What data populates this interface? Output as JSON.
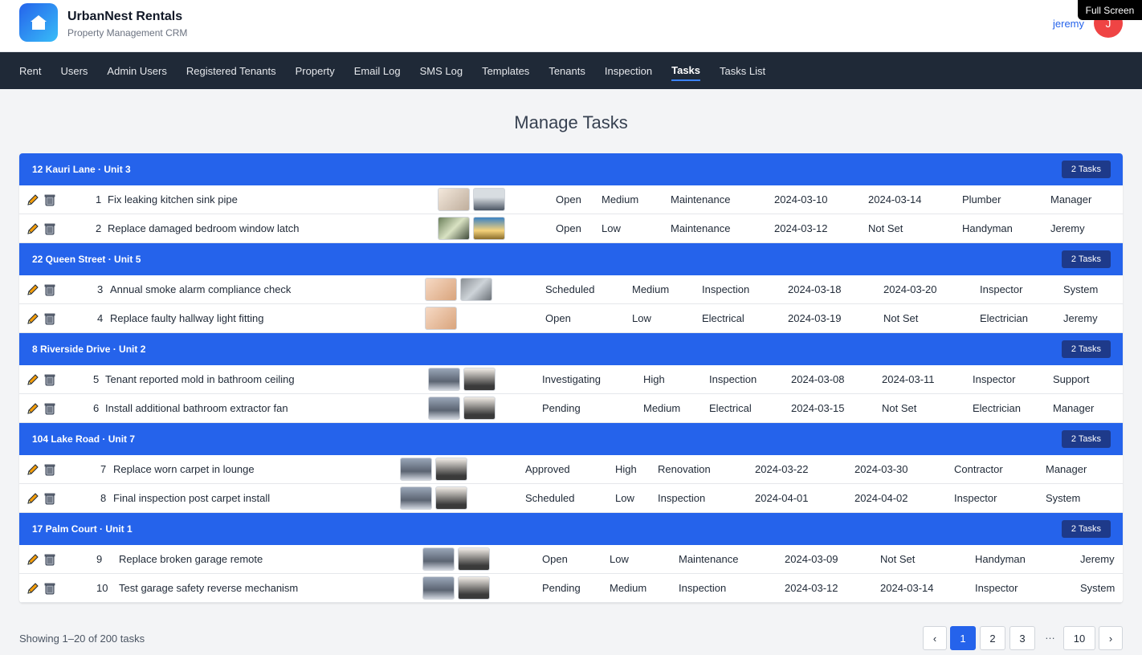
{
  "app": {
    "name": "UrbanNest Rentals",
    "subtitle": "Property Management CRM"
  },
  "user": {
    "name": "jeremy",
    "initial": "J"
  },
  "fullscreen_label": "Full Screen",
  "nav": [
    "Rent",
    "Users",
    "Admin Users",
    "Registered Tenants",
    "Property",
    "Email Log",
    "SMS Log",
    "Templates",
    "Tenants",
    "Inspection",
    "Tasks",
    "Tasks List"
  ],
  "nav_active": "Tasks",
  "page_title": "Manage Tasks",
  "groups": [
    {
      "title": "12 Kauri Lane · Unit 3",
      "count": "2 Tasks",
      "tasks": [
        {
          "num": "1",
          "title": "Fix leaking kitchen sink pipe",
          "status": "Open",
          "priority": "Medium",
          "category": "Maintenance",
          "created": "2024-03-10",
          "due": "2024-03-14",
          "assignee": "Plumber",
          "creator": "Manager"
        },
        {
          "num": "2",
          "title": "Replace damaged bedroom window latch",
          "status": "Open",
          "priority": "Low",
          "category": "Maintenance",
          "created": "2024-03-12",
          "due": "Not Set",
          "assignee": "Handyman",
          "creator": "Jeremy"
        }
      ]
    },
    {
      "title": "22 Queen Street · Unit 5",
      "count": "2 Tasks",
      "tasks": [
        {
          "num": "3",
          "title": "Annual smoke alarm compliance check",
          "status": "Scheduled",
          "priority": "Medium",
          "category": "Inspection",
          "created": "2024-03-18",
          "due": "2024-03-20",
          "assignee": "Inspector",
          "creator": "System"
        },
        {
          "num": "4",
          "title": "Replace faulty hallway light fitting",
          "status": "Open",
          "priority": "Low",
          "category": "Electrical",
          "created": "2024-03-19",
          "due": "Not Set",
          "assignee": "Electrician",
          "creator": "Jeremy"
        }
      ]
    },
    {
      "title": "8 Riverside Drive · Unit 2",
      "count": "2 Tasks",
      "tasks": [
        {
          "num": "5",
          "title": "Tenant reported mold in bathroom ceiling",
          "status": "Investigating",
          "priority": "High",
          "category": "Inspection",
          "created": "2024-03-08",
          "due": "2024-03-11",
          "assignee": "Inspector",
          "creator": "Support"
        },
        {
          "num": "6",
          "title": "Install additional bathroom extractor fan",
          "status": "Pending",
          "priority": "Medium",
          "category": "Electrical",
          "created": "2024-03-15",
          "due": "Not Set",
          "assignee": "Electrician",
          "creator": "Manager"
        }
      ]
    },
    {
      "title": "104 Lake Road · Unit 7",
      "count": "2 Tasks",
      "tasks": [
        {
          "num": "7",
          "title": "Replace worn carpet in lounge",
          "status": "Approved",
          "priority": "High",
          "category": "Renovation",
          "created": "2024-03-22",
          "due": "2024-03-30",
          "assignee": "Contractor",
          "creator": "Manager"
        },
        {
          "num": "8",
          "title": "Final inspection post carpet install",
          "status": "Scheduled",
          "priority": "Low",
          "category": "Inspection",
          "created": "2024-04-01",
          "due": "2024-04-02",
          "assignee": "Inspector",
          "creator": "System"
        }
      ]
    },
    {
      "title": "17 Palm Court · Unit 1",
      "count": "2 Tasks",
      "tasks": [
        {
          "num": "9",
          "title": "Replace broken garage remote",
          "status": "Open",
          "priority": "Low",
          "category": "Maintenance",
          "created": "2024-03-09",
          "due": "Not Set",
          "assignee": "Handyman",
          "creator": "Jeremy"
        },
        {
          "num": "10",
          "title": "Test garage safety reverse mechanism",
          "status": "Pending",
          "priority": "Medium",
          "category": "Inspection",
          "created": "2024-03-12",
          "due": "2024-03-14",
          "assignee": "Inspector",
          "creator": "System"
        }
      ]
    }
  ],
  "footer": {
    "summary": "Showing 1–20 of 200 tasks",
    "prev": "‹",
    "next": "›",
    "pages": [
      "1",
      "2",
      "3"
    ],
    "ellipsis": "…",
    "last": "10",
    "current": "1"
  },
  "colors": {
    "accent": "#2563eb",
    "nav_bg": "#1f2937",
    "avatar": "#ef4444",
    "badge": "#1e3a8a"
  },
  "icons": {
    "edit": "pencil-icon",
    "delete": "trash-icon",
    "logo": "home-icon"
  }
}
